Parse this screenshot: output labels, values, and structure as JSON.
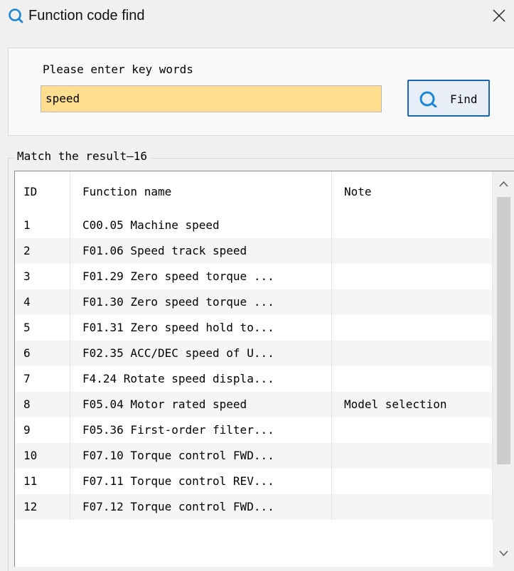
{
  "window": {
    "title": "Function code find",
    "title_icon": "search-icon",
    "close_icon": "close-icon"
  },
  "search": {
    "prompt": "Please enter key words",
    "value": "speed",
    "find_label": "Find",
    "input_color": "#ffdf8f",
    "button_border_color": "#1a63b8"
  },
  "results": {
    "title": "Match the result—16",
    "columns": [
      "ID",
      "Function name",
      "Note"
    ],
    "rows": [
      {
        "id": "1",
        "name": "C00.05 Machine speed",
        "note": ""
      },
      {
        "id": "2",
        "name": "F01.06 Speed track speed",
        "note": ""
      },
      {
        "id": "3",
        "name": "F01.29 Zero speed torque ...",
        "note": ""
      },
      {
        "id": "4",
        "name": "F01.30 Zero speed torque ...",
        "note": ""
      },
      {
        "id": "5",
        "name": "F01.31 Zero speed hold to...",
        "note": ""
      },
      {
        "id": "6",
        "name": "F02.35 ACC/DEC speed of U...",
        "note": ""
      },
      {
        "id": "7",
        "name": "F4.24 Rotate speed displa...",
        "note": ""
      },
      {
        "id": "8",
        "name": "F05.04 Motor rated speed",
        "note": "Model selection"
      },
      {
        "id": "9",
        "name": "F05.36 First-order filter...",
        "note": ""
      },
      {
        "id": "10",
        "name": "F07.10 Torque control FWD...",
        "note": ""
      },
      {
        "id": "11",
        "name": "F07.11 Torque control REV...",
        "note": ""
      },
      {
        "id": "12",
        "name": "F07.12 Torque control FWD...",
        "note": ""
      }
    ],
    "scroll_position": 0
  }
}
